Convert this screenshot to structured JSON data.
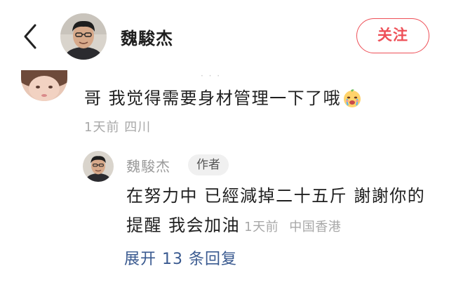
{
  "header": {
    "name": "魏駿杰",
    "follow_label": "关注"
  },
  "comment": {
    "text": "哥 我觉得需要身材管理一下了哦",
    "emoji": "crying-face",
    "time": "1天前",
    "location": "四川"
  },
  "reply": {
    "author": "魏駿杰",
    "badge": "作者",
    "line1": "在努力中 已經減掉二十五斤 謝謝你的",
    "line2": "提醒 我会加油",
    "time": "1天前",
    "location": "中国香港"
  },
  "expand_label": "展开 13 条回复",
  "colors": {
    "accent": "#ee4f57",
    "link": "#3a5a90",
    "meta": "#a8a8a8"
  }
}
